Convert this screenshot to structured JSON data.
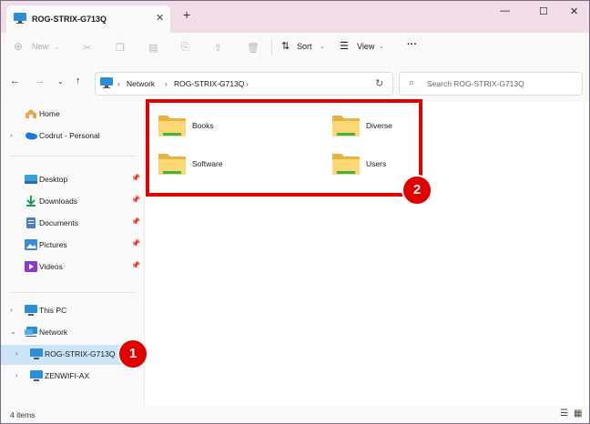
{
  "window": {
    "tab_title": "ROG-STRIX-G713Q",
    "tab_close": "✕",
    "new_tab": "+",
    "controls": {
      "minimize": "—",
      "maximize": "☐",
      "close": "✕"
    }
  },
  "toolbar": {
    "new_label": "New",
    "sort_label": "Sort",
    "view_label": "View",
    "more_label": "···"
  },
  "address": {
    "crumbs": [
      "Network",
      "ROG-STRIX-G713Q"
    ],
    "search_placeholder": "Search ROG-STRIX-G713Q"
  },
  "sidebar": {
    "items": [
      {
        "label": "Home",
        "icon": "home-icon"
      },
      {
        "label": "Codrut - Personal",
        "icon": "onedrive-cloud-icon"
      },
      {
        "label": "Desktop",
        "icon": "desktop-icon",
        "pinned": true
      },
      {
        "label": "Downloads",
        "icon": "download-icon",
        "pinned": true
      },
      {
        "label": "Documents",
        "icon": "documents-icon",
        "pinned": true
      },
      {
        "label": "Pictures",
        "icon": "pictures-icon",
        "pinned": true
      },
      {
        "label": "Videos",
        "icon": "videos-icon",
        "pinned": true
      },
      {
        "label": "This PC",
        "icon": "pc-icon"
      },
      {
        "label": "Network",
        "icon": "network-icon"
      },
      {
        "label": "ROG-STRIX-G713Q",
        "icon": "computer-icon",
        "selected": true
      },
      {
        "label": "ZENWIFI-AX",
        "icon": "computer-icon"
      }
    ]
  },
  "content": {
    "folders": [
      "Books",
      "Diverse",
      "Software",
      "Users"
    ]
  },
  "status": {
    "item_count": "4 items"
  },
  "annotations": {
    "badge1": "1",
    "badge2": "2",
    "highlight_color": "#e00000"
  }
}
